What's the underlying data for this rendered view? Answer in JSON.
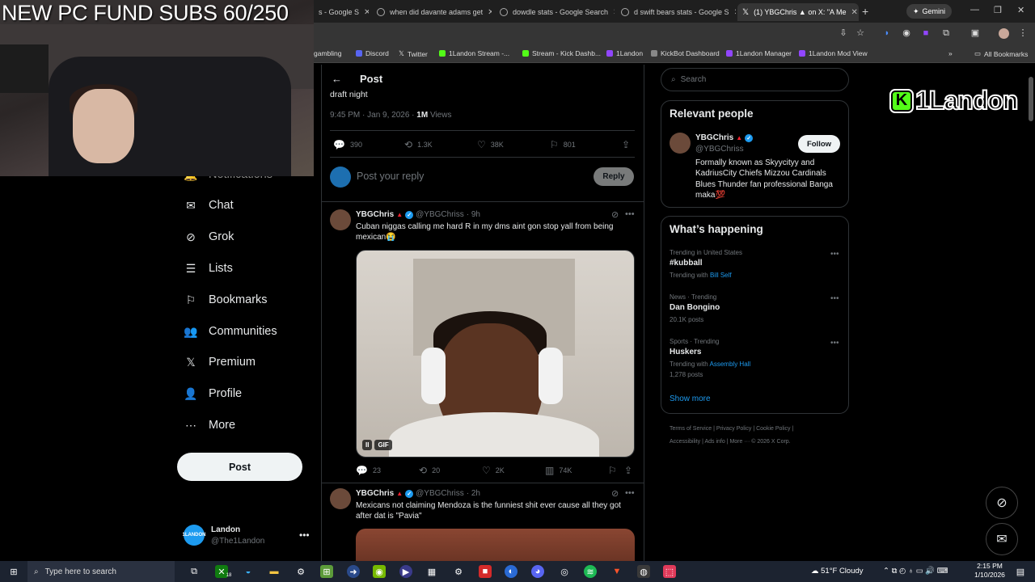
{
  "browser": {
    "tabs": [
      {
        "title": "s - Google S",
        "active": false
      },
      {
        "title": "when did davante adams get",
        "active": false
      },
      {
        "title": "dowdle stats - Google Search",
        "active": false
      },
      {
        "title": "d swift bears stats - Google S",
        "active": false
      },
      {
        "title": "(1) YBGChris ▲ on X: \"A Me",
        "active": true
      }
    ],
    "new_tab": "+",
    "gemini_label": "Gemini",
    "bookmarks": [
      "gambling",
      "Discord",
      "Twitter",
      "1Landon Stream -...",
      "Stream - Kick Dashb...",
      "1Landon",
      "KickBot Dashboard",
      "1Landon Manager",
      "1Landon Mod View"
    ],
    "all_bookmarks": "All Bookmarks",
    "bookmark_overflow": "»"
  },
  "overlay": {
    "title": "NEW PC FUND SUBS 60/250",
    "logo_letter": "K",
    "logo_text": "1Landon"
  },
  "sidebar": {
    "partial_item": "Notifications",
    "items": [
      {
        "label": "Chat",
        "icon": "mail-icon"
      },
      {
        "label": "Grok",
        "icon": "grok-icon"
      },
      {
        "label": "Lists",
        "icon": "list-icon"
      },
      {
        "label": "Bookmarks",
        "icon": "bookmark-icon"
      },
      {
        "label": "Communities",
        "icon": "people-icon"
      },
      {
        "label": "Premium",
        "icon": "x-logo-icon"
      },
      {
        "label": "Profile",
        "icon": "person-icon"
      },
      {
        "label": "More",
        "icon": "more-circle-icon"
      }
    ],
    "post_label": "Post",
    "user": {
      "name": "Landon",
      "handle": "@The1Landon",
      "avatar_text": "1LANDON"
    }
  },
  "main": {
    "header": "Post",
    "draft_text": "draft night",
    "meta_time": "9:45 PM · Jan 9, 2026 · ",
    "meta_views_num": "1M",
    "meta_views_label": " Views",
    "stats": {
      "replies": "390",
      "reposts": "1.3K",
      "likes": "38K",
      "bookmarks": "801"
    },
    "reply_placeholder": "Post your reply",
    "reply_button": "Reply",
    "tweets": [
      {
        "name": "YBGChris",
        "handle": "@YBGChriss",
        "time": "· 9h",
        "text": "Cuban niggas calling me hard R in my dms aint gon stop yall from being mexican😭",
        "gif_label": "GIF",
        "pause": "II",
        "stats": {
          "replies": "23",
          "reposts": "20",
          "likes": "2K",
          "views": "74K"
        }
      },
      {
        "name": "YBGChris",
        "handle": "@YBGChriss",
        "time": "· 2h",
        "text": "Mexicans not claiming Mendoza is the funniest shit ever cause all they got after dat is \"Pavia\""
      }
    ]
  },
  "right": {
    "search_placeholder": "Search",
    "relevant_title": "Relevant people",
    "person": {
      "name": "YBGChris",
      "handle": "@YBGChriss",
      "follow": "Follow",
      "bio": "Formally known as Skyycityy and KadriusCity Chiefs Mizzou Cardinals Blues Thunder fan professional Banga maka💯"
    },
    "happening_title": "What’s happening",
    "trends": [
      {
        "meta": "Trending in United States",
        "name": "#kubball",
        "sub_prefix": "Trending with ",
        "sub_link": "Bill Self"
      },
      {
        "meta": "News · Trending",
        "name": "Dan Bongino",
        "sub_prefix": "20.1K posts",
        "sub_link": ""
      },
      {
        "meta": "Sports · Trending",
        "name": "Huskers",
        "sub_prefix": "Trending with ",
        "sub_link": "Assembly Hall",
        "extra": "1,278 posts"
      }
    ],
    "show_more": "Show more",
    "footer_line1": "Terms of Service  |  Privacy Policy  |  Cookie Policy  |",
    "footer_line2": "Accessibility  |  Ads info  |  More ···  © 2026 X Corp."
  },
  "taskbar": {
    "search_placeholder": "Type here to search",
    "weather": "51°F  Cloudy",
    "time": "2:15 PM",
    "date": "1/10/2026",
    "badge": "18"
  }
}
